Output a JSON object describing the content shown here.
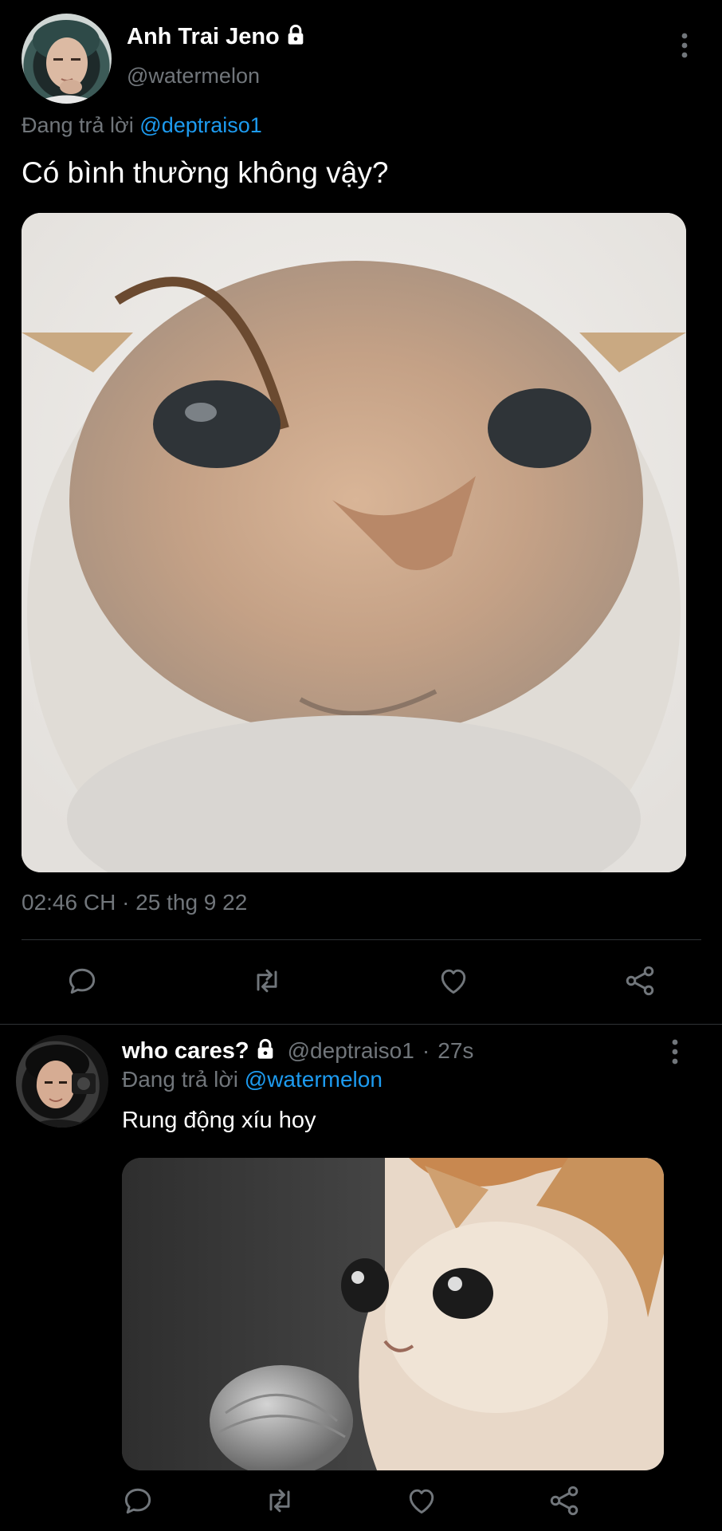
{
  "main_tweet": {
    "author_name": "Anh Trai Jeno",
    "author_handle": "@watermelon",
    "reply_prefix": "Đang trả lời",
    "reply_to": "@deptraiso1",
    "text": "Có bình thường không vậy?",
    "timestamp": "02:46 CH · 25 thg 9 22",
    "actions": [
      "reply-icon",
      "retweet-icon",
      "like-icon",
      "share-icon"
    ]
  },
  "reply_tweet": {
    "author_name": "who cares?",
    "author_handle": "@deptraiso1",
    "separator": "·",
    "time": "27s",
    "reply_prefix": "Đang trả lời",
    "reply_to": "@watermelon",
    "text": "Rung động xíu hoy",
    "actions": [
      "reply-icon",
      "retweet-icon",
      "like-icon",
      "share-icon"
    ]
  },
  "colors": {
    "background": "#000000",
    "text": "#ffffff",
    "secondary": "#71767b",
    "accent": "#1d9bf0",
    "divider": "#2f3336"
  }
}
